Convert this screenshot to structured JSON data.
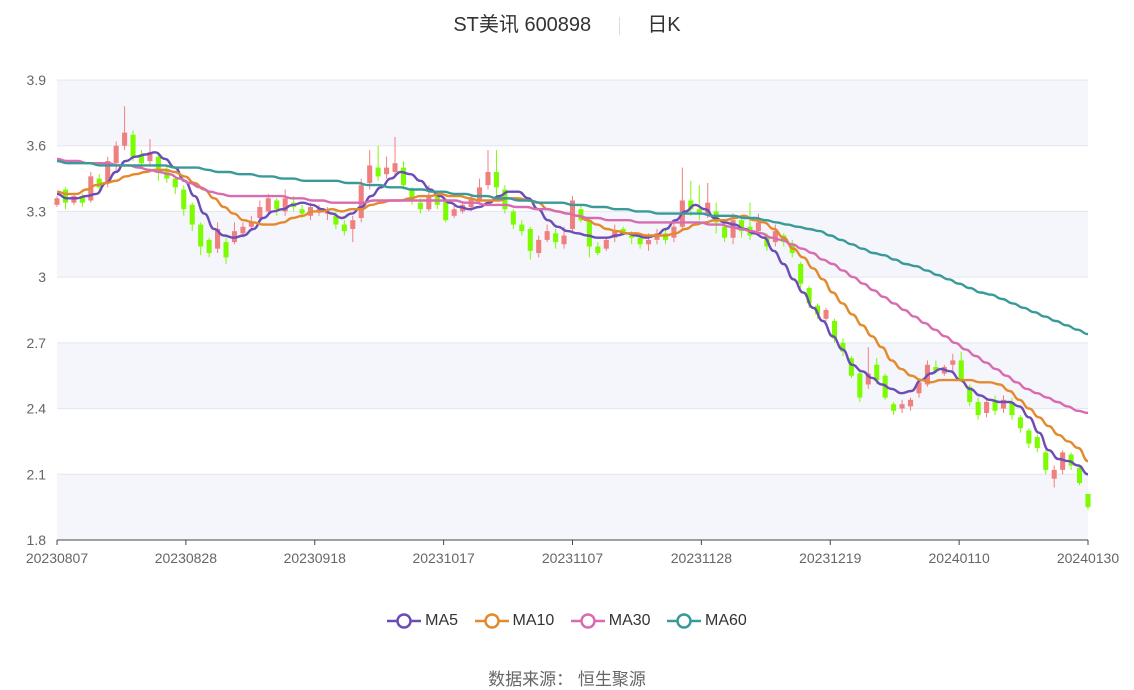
{
  "header": {
    "stock_name": "ST美讯 600898",
    "period": "日K"
  },
  "source": {
    "label": "数据来源：",
    "value": "恒生聚源"
  },
  "colors": {
    "up": "#f08080",
    "down": "#7cfc00",
    "ma5": "#6c4db5",
    "ma10": "#e38a2e",
    "ma30": "#d86cb0",
    "ma60": "#3a9a99",
    "band": "#f5f6fb",
    "grid": "#e4e6ef",
    "axis": "#444444"
  },
  "chart_data": {
    "type": "candlestick",
    "ylim": [
      1.8,
      3.9
    ],
    "yticks": [
      "1.8",
      "2.1",
      "2.4",
      "2.7",
      "3",
      "3.3",
      "3.6",
      "3.9"
    ],
    "xticks": [
      "20230807",
      "20230828",
      "20230918",
      "20231017",
      "20231107",
      "20231128",
      "20231219",
      "20240110",
      "20240130"
    ],
    "legend": [
      "MA5",
      "MA10",
      "MA30",
      "MA60"
    ],
    "candles": [
      [
        3.33,
        3.36,
        3.37,
        3.32
      ],
      [
        3.4,
        3.34,
        3.41,
        3.31
      ],
      [
        3.34,
        3.37,
        3.38,
        3.33
      ],
      [
        3.37,
        3.34,
        3.38,
        3.32
      ],
      [
        3.35,
        3.46,
        3.48,
        3.34
      ],
      [
        3.45,
        3.41,
        3.47,
        3.38
      ],
      [
        3.43,
        3.53,
        3.55,
        3.41
      ],
      [
        3.52,
        3.6,
        3.62,
        3.48
      ],
      [
        3.6,
        3.66,
        3.78,
        3.58
      ],
      [
        3.65,
        3.55,
        3.67,
        3.53
      ],
      [
        3.56,
        3.52,
        3.58,
        3.5
      ],
      [
        3.53,
        3.57,
        3.63,
        3.51
      ],
      [
        3.55,
        3.49,
        3.56,
        3.44
      ],
      [
        3.49,
        3.45,
        3.51,
        3.43
      ],
      [
        3.45,
        3.41,
        3.46,
        3.38
      ],
      [
        3.4,
        3.31,
        3.42,
        3.28
      ],
      [
        3.33,
        3.24,
        3.34,
        3.21
      ],
      [
        3.24,
        3.14,
        3.25,
        3.1
      ],
      [
        3.17,
        3.11,
        3.18,
        3.09
      ],
      [
        3.13,
        3.22,
        3.25,
        3.11
      ],
      [
        3.16,
        3.09,
        3.18,
        3.06
      ],
      [
        3.16,
        3.21,
        3.25,
        3.15
      ],
      [
        3.2,
        3.23,
        3.25,
        3.18
      ],
      [
        3.23,
        3.25,
        3.28,
        3.21
      ],
      [
        3.27,
        3.32,
        3.35,
        3.25
      ],
      [
        3.3,
        3.36,
        3.38,
        3.28
      ],
      [
        3.35,
        3.31,
        3.36,
        3.28
      ],
      [
        3.3,
        3.36,
        3.4,
        3.28
      ],
      [
        3.34,
        3.32,
        3.37,
        3.3
      ],
      [
        3.31,
        3.29,
        3.33,
        3.27
      ],
      [
        3.28,
        3.32,
        3.34,
        3.26
      ],
      [
        3.3,
        3.31,
        3.33,
        3.28
      ],
      [
        3.29,
        3.3,
        3.32,
        3.26
      ],
      [
        3.28,
        3.24,
        3.3,
        3.22
      ],
      [
        3.24,
        3.21,
        3.26,
        3.19
      ],
      [
        3.22,
        3.26,
        3.28,
        3.16
      ],
      [
        3.27,
        3.42,
        3.45,
        3.25
      ],
      [
        3.43,
        3.51,
        3.58,
        3.4
      ],
      [
        3.5,
        3.46,
        3.6,
        3.44
      ],
      [
        3.47,
        3.5,
        3.55,
        3.45
      ],
      [
        3.48,
        3.52,
        3.64,
        3.46
      ],
      [
        3.5,
        3.42,
        3.53,
        3.4
      ],
      [
        3.4,
        3.35,
        3.41,
        3.33
      ],
      [
        3.34,
        3.31,
        3.36,
        3.29
      ],
      [
        3.31,
        3.37,
        3.42,
        3.3
      ],
      [
        3.37,
        3.33,
        3.39,
        3.31
      ],
      [
        3.35,
        3.26,
        3.36,
        3.25
      ],
      [
        3.28,
        3.31,
        3.33,
        3.27
      ],
      [
        3.3,
        3.33,
        3.34,
        3.29
      ],
      [
        3.32,
        3.36,
        3.38,
        3.3
      ],
      [
        3.35,
        3.41,
        3.45,
        3.33
      ],
      [
        3.42,
        3.48,
        3.58,
        3.4
      ],
      [
        3.48,
        3.41,
        3.58,
        3.37
      ],
      [
        3.4,
        3.31,
        3.42,
        3.29
      ],
      [
        3.3,
        3.24,
        3.31,
        3.22
      ],
      [
        3.24,
        3.21,
        3.26,
        3.19
      ],
      [
        3.22,
        3.12,
        3.23,
        3.08
      ],
      [
        3.11,
        3.17,
        3.19,
        3.09
      ],
      [
        3.17,
        3.21,
        3.24,
        3.16
      ],
      [
        3.2,
        3.16,
        3.22,
        3.13
      ],
      [
        3.15,
        3.19,
        3.23,
        3.13
      ],
      [
        3.22,
        3.35,
        3.37,
        3.2
      ],
      [
        3.31,
        3.26,
        3.33,
        3.25
      ],
      [
        3.26,
        3.14,
        3.27,
        3.09
      ],
      [
        3.14,
        3.11,
        3.16,
        3.1
      ],
      [
        3.13,
        3.17,
        3.18,
        3.12
      ],
      [
        3.18,
        3.21,
        3.24,
        3.16
      ],
      [
        3.22,
        3.2,
        3.23,
        3.19
      ],
      [
        3.19,
        3.18,
        3.21,
        3.15
      ],
      [
        3.18,
        3.15,
        3.2,
        3.13
      ],
      [
        3.15,
        3.17,
        3.2,
        3.12
      ],
      [
        3.17,
        3.2,
        3.22,
        3.15
      ],
      [
        3.2,
        3.17,
        3.22,
        3.15
      ],
      [
        3.18,
        3.23,
        3.26,
        3.16
      ],
      [
        3.23,
        3.35,
        3.5,
        3.21
      ],
      [
        3.35,
        3.31,
        3.44,
        3.28
      ],
      [
        3.31,
        3.29,
        3.42,
        3.26
      ],
      [
        3.29,
        3.34,
        3.43,
        3.27
      ],
      [
        3.3,
        3.25,
        3.34,
        3.2
      ],
      [
        3.23,
        3.18,
        3.26,
        3.16
      ],
      [
        3.18,
        3.26,
        3.29,
        3.15
      ],
      [
        3.26,
        3.21,
        3.27,
        3.18
      ],
      [
        3.23,
        3.19,
        3.34,
        3.17
      ],
      [
        3.21,
        3.25,
        3.29,
        3.19
      ],
      [
        3.19,
        3.14,
        3.2,
        3.12
      ],
      [
        3.16,
        3.21,
        3.24,
        3.14
      ],
      [
        3.19,
        3.16,
        3.2,
        3.14
      ],
      [
        3.15,
        3.11,
        3.17,
        3.09
      ],
      [
        3.06,
        2.97,
        3.07,
        2.95
      ],
      [
        2.95,
        2.88,
        2.96,
        2.86
      ],
      [
        2.87,
        2.83,
        2.88,
        2.81
      ],
      [
        2.81,
        2.85,
        2.86,
        2.8
      ],
      [
        2.8,
        2.72,
        2.81,
        2.7
      ],
      [
        2.7,
        2.66,
        2.72,
        2.64
      ],
      [
        2.63,
        2.55,
        2.64,
        2.54
      ],
      [
        2.56,
        2.45,
        2.57,
        2.43
      ],
      [
        2.51,
        2.56,
        2.68,
        2.49
      ],
      [
        2.6,
        2.53,
        2.63,
        2.51
      ],
      [
        2.55,
        2.45,
        2.56,
        2.44
      ],
      [
        2.42,
        2.39,
        2.43,
        2.37
      ],
      [
        2.4,
        2.42,
        2.44,
        2.38
      ],
      [
        2.41,
        2.44,
        2.45,
        2.39
      ],
      [
        2.47,
        2.52,
        2.53,
        2.45
      ],
      [
        2.51,
        2.6,
        2.62,
        2.5
      ],
      [
        2.59,
        2.57,
        2.62,
        2.56
      ],
      [
        2.56,
        2.59,
        2.6,
        2.55
      ],
      [
        2.6,
        2.62,
        2.65,
        2.56
      ],
      [
        2.62,
        2.53,
        2.66,
        2.52
      ],
      [
        2.5,
        2.43,
        2.51,
        2.41
      ],
      [
        2.43,
        2.37,
        2.45,
        2.35
      ],
      [
        2.38,
        2.43,
        2.45,
        2.36
      ],
      [
        2.44,
        2.39,
        2.46,
        2.37
      ],
      [
        2.4,
        2.44,
        2.46,
        2.38
      ],
      [
        2.43,
        2.37,
        2.45,
        2.35
      ],
      [
        2.36,
        2.31,
        2.37,
        2.29
      ],
      [
        2.3,
        2.24,
        2.31,
        2.22
      ],
      [
        2.27,
        2.22,
        2.28,
        2.2
      ],
      [
        2.2,
        2.12,
        2.21,
        2.1
      ],
      [
        2.08,
        2.12,
        2.14,
        2.04
      ],
      [
        2.12,
        2.2,
        2.21,
        2.1
      ],
      [
        2.19,
        2.14,
        2.2,
        2.12
      ],
      [
        2.13,
        2.06,
        2.14,
        2.05
      ],
      [
        2.01,
        1.95,
        2.01,
        1.94
      ]
    ],
    "series": [
      {
        "name": "MA5",
        "values": [
          3.38,
          3.36,
          3.36,
          3.37,
          3.38,
          3.43,
          3.48,
          3.53,
          3.55,
          3.56,
          3.57,
          3.54,
          3.5,
          3.44,
          3.37,
          3.29,
          3.22,
          3.19,
          3.18,
          3.19,
          3.22,
          3.27,
          3.3,
          3.31,
          3.33,
          3.34,
          3.33,
          3.31,
          3.29,
          3.27,
          3.29,
          3.32,
          3.37,
          3.41,
          3.45,
          3.48,
          3.47,
          3.44,
          3.4,
          3.37,
          3.34,
          3.32,
          3.31,
          3.32,
          3.34,
          3.37,
          3.39,
          3.39,
          3.36,
          3.31,
          3.26,
          3.23,
          3.21,
          3.2,
          3.19,
          3.18,
          3.18,
          3.19,
          3.2,
          3.19,
          3.18,
          3.19,
          3.22,
          3.26,
          3.3,
          3.33,
          3.31,
          3.27,
          3.25,
          3.24,
          3.22,
          3.2,
          3.18,
          3.12,
          3.06,
          2.99,
          2.93,
          2.86,
          2.8,
          2.73,
          2.67,
          2.6,
          2.57,
          2.54,
          2.51,
          2.49,
          2.47,
          2.48,
          2.53,
          2.56,
          2.58,
          2.57,
          2.53,
          2.49,
          2.46,
          2.44,
          2.43,
          2.43,
          2.41,
          2.36,
          2.29,
          2.21,
          2.17,
          2.16,
          2.14,
          2.1
        ]
      },
      {
        "name": "MA10",
        "values": [
          3.39,
          3.38,
          3.38,
          3.4,
          3.42,
          3.43,
          3.44,
          3.46,
          3.47,
          3.48,
          3.49,
          3.49,
          3.48,
          3.46,
          3.43,
          3.4,
          3.36,
          3.32,
          3.29,
          3.26,
          3.25,
          3.24,
          3.24,
          3.25,
          3.27,
          3.28,
          3.3,
          3.3,
          3.31,
          3.3,
          3.31,
          3.31,
          3.33,
          3.34,
          3.35,
          3.35,
          3.36,
          3.37,
          3.37,
          3.38,
          3.37,
          3.37,
          3.36,
          3.35,
          3.35,
          3.35,
          3.36,
          3.36,
          3.35,
          3.34,
          3.31,
          3.3,
          3.29,
          3.28,
          3.26,
          3.24,
          3.22,
          3.21,
          3.2,
          3.2,
          3.19,
          3.19,
          3.19,
          3.2,
          3.22,
          3.24,
          3.25,
          3.26,
          3.26,
          3.27,
          3.28,
          3.26,
          3.25,
          3.22,
          3.18,
          3.13,
          3.09,
          3.04,
          2.99,
          2.93,
          2.88,
          2.83,
          2.78,
          2.73,
          2.68,
          2.62,
          2.58,
          2.55,
          2.53,
          2.52,
          2.53,
          2.53,
          2.53,
          2.53,
          2.52,
          2.52,
          2.51,
          2.48,
          2.44,
          2.4,
          2.36,
          2.32,
          2.28,
          2.25,
          2.22,
          2.16
        ]
      },
      {
        "name": "MA30",
        "values": [
          3.54,
          3.53,
          3.53,
          3.52,
          3.52,
          3.52,
          3.51,
          3.51,
          3.5,
          3.49,
          3.48,
          3.47,
          3.45,
          3.43,
          3.41,
          3.39,
          3.38,
          3.37,
          3.37,
          3.37,
          3.37,
          3.37,
          3.37,
          3.36,
          3.36,
          3.35,
          3.35,
          3.34,
          3.34,
          3.34,
          3.34,
          3.35,
          3.35,
          3.35,
          3.35,
          3.35,
          3.35,
          3.35,
          3.35,
          3.35,
          3.34,
          3.34,
          3.33,
          3.33,
          3.33,
          3.32,
          3.32,
          3.31,
          3.31,
          3.3,
          3.29,
          3.28,
          3.27,
          3.27,
          3.26,
          3.26,
          3.26,
          3.25,
          3.25,
          3.25,
          3.25,
          3.25,
          3.25,
          3.25,
          3.24,
          3.24,
          3.23,
          3.22,
          3.21,
          3.2,
          3.18,
          3.17,
          3.15,
          3.13,
          3.11,
          3.08,
          3.06,
          3.03,
          3.0,
          2.97,
          2.94,
          2.91,
          2.88,
          2.85,
          2.82,
          2.79,
          2.76,
          2.73,
          2.7,
          2.67,
          2.64,
          2.61,
          2.58,
          2.55,
          2.52,
          2.49,
          2.47,
          2.45,
          2.43,
          2.41,
          2.39,
          2.38
        ]
      },
      {
        "name": "MA60",
        "values": [
          3.53,
          3.52,
          3.52,
          3.52,
          3.51,
          3.51,
          3.51,
          3.51,
          3.51,
          3.51,
          3.51,
          3.5,
          3.5,
          3.5,
          3.49,
          3.48,
          3.48,
          3.47,
          3.47,
          3.46,
          3.46,
          3.45,
          3.45,
          3.44,
          3.44,
          3.44,
          3.44,
          3.43,
          3.43,
          3.42,
          3.42,
          3.41,
          3.41,
          3.4,
          3.4,
          3.39,
          3.39,
          3.38,
          3.38,
          3.37,
          3.37,
          3.36,
          3.36,
          3.35,
          3.35,
          3.34,
          3.34,
          3.34,
          3.33,
          3.33,
          3.32,
          3.32,
          3.31,
          3.31,
          3.3,
          3.3,
          3.29,
          3.29,
          3.29,
          3.29,
          3.29,
          3.28,
          3.28,
          3.28,
          3.27,
          3.27,
          3.26,
          3.25,
          3.24,
          3.23,
          3.22,
          3.21,
          3.19,
          3.17,
          3.15,
          3.13,
          3.11,
          3.1,
          3.08,
          3.06,
          3.05,
          3.03,
          3.01,
          2.99,
          2.97,
          2.95,
          2.93,
          2.92,
          2.9,
          2.88,
          2.86,
          2.84,
          2.82,
          2.8,
          2.78,
          2.76,
          2.74
        ]
      }
    ]
  }
}
